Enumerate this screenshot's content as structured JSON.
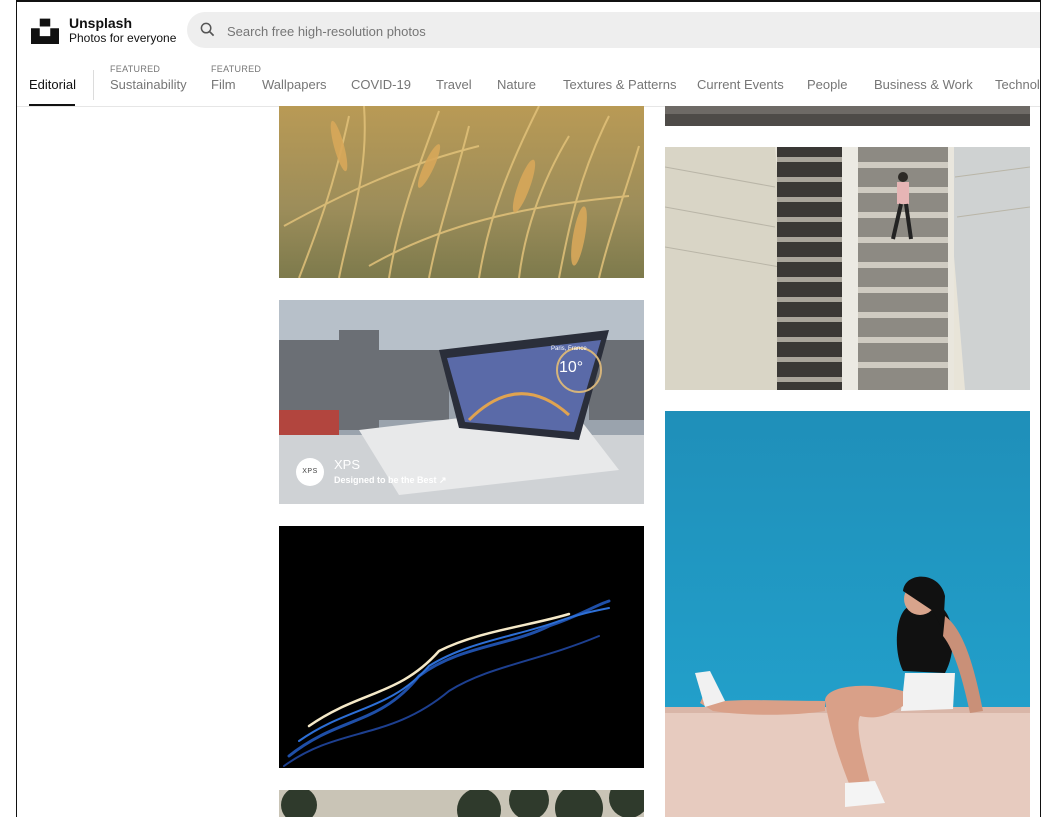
{
  "brand": {
    "name": "Unsplash",
    "tagline": "Photos for everyone"
  },
  "search": {
    "placeholder": "Search free high-resolution photos"
  },
  "nav": {
    "items": [
      {
        "label": "Editorial",
        "active": true
      },
      {
        "label": "Sustainability",
        "featured": "FEATURED"
      },
      {
        "label": "Film",
        "featured": "FEATURED"
      },
      {
        "label": "Wallpapers"
      },
      {
        "label": "COVID-19"
      },
      {
        "label": "Travel"
      },
      {
        "label": "Nature"
      },
      {
        "label": "Textures & Patterns"
      },
      {
        "label": "Current Events"
      },
      {
        "label": "People"
      },
      {
        "label": "Business & Work"
      },
      {
        "label": "Technolo"
      }
    ]
  },
  "ad": {
    "badge": "XPS",
    "title": "XPS",
    "subtitle": "Designed to be the Best ↗",
    "screen_city": "Paris, France",
    "screen_temp": "10°"
  },
  "colors": {
    "nav_active": "#111111",
    "nav_inactive": "#767676",
    "search_bg": "#eeeeee"
  }
}
